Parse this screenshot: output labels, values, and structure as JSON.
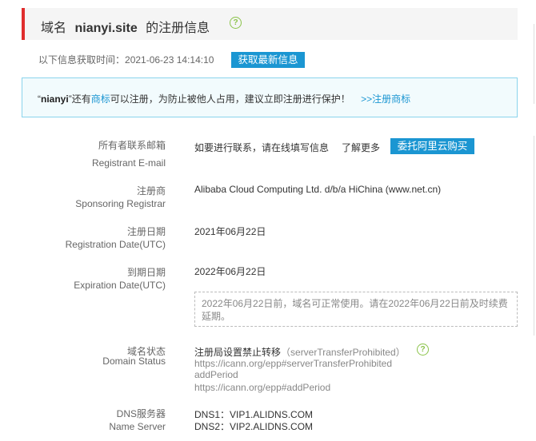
{
  "header": {
    "prefix": "域名",
    "domain": "nianyi.site",
    "suffix": "的注册信息",
    "help_glyph": "?"
  },
  "fetch": {
    "label": "以下信息获取时间：",
    "time": "2021-06-23 14:14:10",
    "button": "获取最新信息"
  },
  "notice": {
    "quote_open": "“",
    "name": "nianyi",
    "quote_close": "”",
    "text_a": "还有",
    "trademark_link": "商标",
    "text_b": "可以注册，为防止被他人占用，建议立即注册进行保护！",
    "register_link": ">>注册商标"
  },
  "registrant": {
    "label_cn": "所有者联系邮箱",
    "label_en": "Registrant E-mail",
    "contact_link": "如要进行联系，请在线填写信息",
    "more_link": "了解更多",
    "buy_button": "委托阿里云购买"
  },
  "registrar": {
    "label_cn": "注册商",
    "label_en": "Sponsoring Registrar",
    "value": "Alibaba Cloud Computing Ltd. d/b/a HiChina (www.net.cn)"
  },
  "reg_date": {
    "label_cn": "注册日期",
    "label_en": "Registration Date(UTC)",
    "value": "2021年06月22日"
  },
  "exp_date": {
    "label_cn": "到期日期",
    "label_en": "Expiration Date(UTC)",
    "value": "2022年06月22日",
    "note_line1": "2022年06月22日前，域名可正常使用。请在2022年06月22日前及时续费",
    "note_line2": "延期。"
  },
  "status": {
    "label_cn": "域名状态",
    "label_en": "Domain Status",
    "title_cn": "注册局设置禁止转移",
    "title_code": "（serverTransferProhibited）",
    "help_glyph": "?",
    "line1": "https://icann.org/epp#serverTransferProhibited",
    "line2": "addPeriod",
    "line3": "https://icann.org/epp#addPeriod"
  },
  "dns": {
    "label_cn": "DNS服务器",
    "label_en": "Name Server",
    "ns1": "DNS1：VIP1.ALIDNS.COM",
    "ns2": "DNS2：VIP2.ALIDNS.COM"
  },
  "colors": {
    "accent_red": "#e02d2d",
    "link_blue": "#1b96d2",
    "help_green": "#8bc34a",
    "notice_border": "#8ad4ec"
  }
}
